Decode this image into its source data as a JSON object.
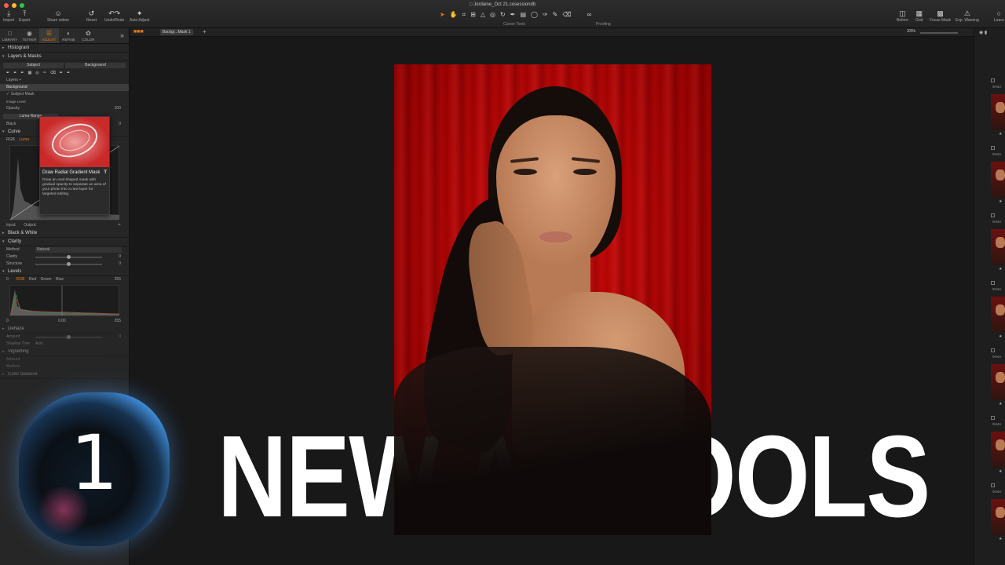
{
  "window": {
    "title": "Jordaine_Oct 21.cosessiondb"
  },
  "toolbar": {
    "import": "Import",
    "export": "Export",
    "share_online": "Share online",
    "reset": "Reset",
    "undo_redo": "Undo/Redo",
    "auto_adjust": "Auto Adjust",
    "cursor_tools": "Cursor Tools",
    "proofing": "Proofing",
    "before": "Before",
    "grid": "Grid",
    "focus_mask": "Focus Mask",
    "exp_warning": "Exp. Warning",
    "learn": "Learn"
  },
  "tabs": [
    "LIBRARY",
    "TETHER",
    "ADJUST",
    "REFINE",
    "COLOR"
  ],
  "panel": {
    "histogram": "Histogram",
    "layers_masks": "Layers & Masks",
    "subject": "Subject",
    "background": "Background",
    "layers_label": "Layers",
    "layer_background": "Background",
    "layer_subject_mask": "Subject Mask",
    "layer_image_level": "Image Level",
    "opacity_label": "Opacity",
    "opacity_value": "100",
    "luma_range": "Luma Range",
    "black_label": "Black",
    "black_value": "0",
    "curve": "Curve",
    "curve_rgb": "RGB",
    "curve_luma": "Luma",
    "input_label": "Input:",
    "output_label": "Output:",
    "black_white": "Black & White",
    "clarity": "Clarity",
    "method_label": "Method",
    "method_value": "Natural",
    "clarity_label": "Clarity",
    "clarity_value": "0",
    "structure_label": "Structure",
    "structure_value": "0",
    "levels": "Levels",
    "levels_left": "0",
    "levels_rgb": "RGB",
    "levels_red": "Red",
    "levels_green": "Green",
    "levels_blue": "Blue",
    "levels_right": "255",
    "levels_in_low": "0",
    "levels_mid": "0.00",
    "levels_in_high": "255",
    "dehaze": "Dehaze",
    "amount_label": "Amount",
    "amount_value": "0",
    "shadow_tone_label": "Shadow Tone",
    "shadow_tone_value": "Auto",
    "vignetting": "Vignetting",
    "vig_amount_label": "Amount",
    "vig_method_label": "Method",
    "color_balance": "Color Balance"
  },
  "tooltip": {
    "title": "Draw Radial Gradient Mask",
    "body": "Draw an oval-shaped mask with gradual opacity to separate an area of your photo into a new layer for targeted editing.",
    "shortcut": "T"
  },
  "viewer": {
    "breadcrumb": "Backgr...Mask 1",
    "zoom": "33%"
  },
  "filmstrip": {
    "label": "0H4A"
  },
  "overlay": {
    "logo_number": "1",
    "headline": "NEW A.I TOOLS"
  },
  "colors": {
    "accent": "#e07a12",
    "backdrop_red": "#c40404",
    "logo_blue": "#3d8ad4"
  }
}
